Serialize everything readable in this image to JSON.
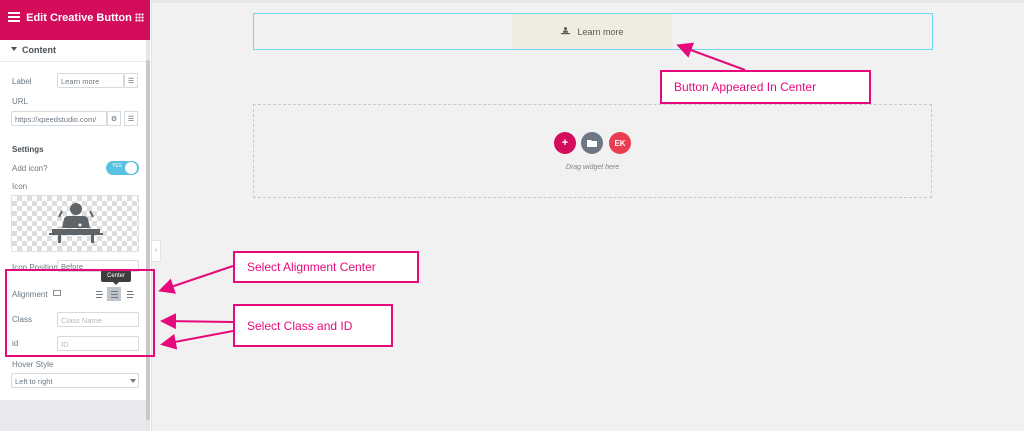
{
  "panel": {
    "title": "Edit Creative Button",
    "section": "Content",
    "label": {
      "label": "Label",
      "value": "Learn more"
    },
    "url": {
      "label": "URL",
      "value": "https://xpeedstudio.com/"
    },
    "settings_heading": "Settings",
    "add_icon": {
      "label": "Add icon?",
      "toggle_text": "YES"
    },
    "icon_label": "Icon",
    "icon_position": {
      "label": "Icon Position",
      "value": "Before"
    },
    "alignment": {
      "label": "Alignment",
      "tooltip": "Center"
    },
    "class": {
      "label": "Class",
      "placeholder": "Class Name"
    },
    "id": {
      "label": "id",
      "placeholder": "ID"
    },
    "hover_style": {
      "label": "Hover Style",
      "value": "Left to right"
    }
  },
  "canvas": {
    "button_label": "Learn more",
    "drag_text": "Drag widget here"
  },
  "annotations": {
    "button_center": "Button Appeared In Center",
    "alignment_center": "Select Alignment Center",
    "class_id": "Select Class and ID"
  },
  "colors": {
    "brand": "#d30c5c",
    "annotation": "#e6097c",
    "toggle": "#5ac1e0"
  }
}
